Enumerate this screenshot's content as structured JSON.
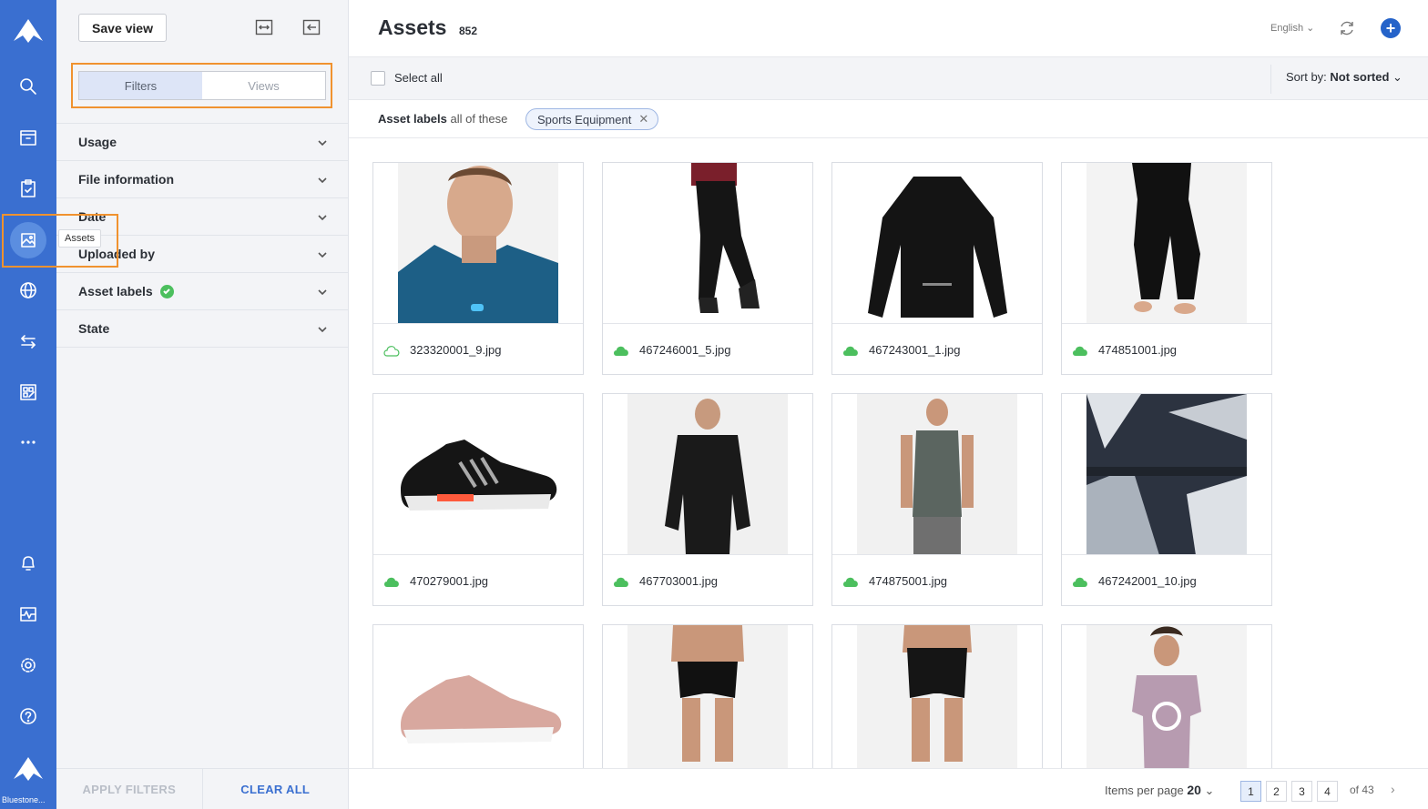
{
  "rail": {
    "user_label": "Bluestone...",
    "tooltip": "Assets",
    "items": [
      "logo-icon",
      "search-icon",
      "archive-icon",
      "clipboard-icon",
      "image-icon",
      "globe-icon",
      "transfer-icon",
      "dashboard-icon",
      "more-icon",
      "bell-icon",
      "activity-icon",
      "gear-icon",
      "help-icon",
      "brand-icon"
    ]
  },
  "filter_panel": {
    "save_view_label": "Save view",
    "tabs": [
      {
        "label": "Filters",
        "active": true
      },
      {
        "label": "Views",
        "active": false
      }
    ],
    "sections": [
      {
        "label": "Usage"
      },
      {
        "label": "File information"
      },
      {
        "label": "Date"
      },
      {
        "label": "Uploaded by"
      },
      {
        "label": "Asset labels"
      },
      {
        "label": "State"
      }
    ],
    "apply_label": "APPLY FILTERS",
    "clear_label": "CLEAR ALL"
  },
  "header": {
    "title": "Assets",
    "count": "852",
    "language": "English"
  },
  "toolbar": {
    "select_all": "Select all",
    "sort_prefix": "Sort by:",
    "sort_value": "Not sorted"
  },
  "active_filter": {
    "label": "Asset labels",
    "qualifier": "all of these",
    "chip": "Sports Equipment"
  },
  "assets": [
    {
      "name": "323320001_9.jpg",
      "synced": false
    },
    {
      "name": "467246001_5.jpg",
      "synced": true
    },
    {
      "name": "467243001_1.jpg",
      "synced": true
    },
    {
      "name": "474851001.jpg",
      "synced": true
    },
    {
      "name": "470279001.jpg",
      "synced": true
    },
    {
      "name": "467703001.jpg",
      "synced": true
    },
    {
      "name": "474875001.jpg",
      "synced": true
    },
    {
      "name": "467242001_10.jpg",
      "synced": true
    },
    {
      "name": "",
      "synced": true
    },
    {
      "name": "",
      "synced": true
    },
    {
      "name": "",
      "synced": true
    },
    {
      "name": "",
      "synced": true
    }
  ],
  "pagination": {
    "items_per_page_label": "Items per page",
    "items_per_page": "20",
    "pages": [
      "1",
      "2",
      "3",
      "4"
    ],
    "current": "1",
    "of_label": "of 43"
  },
  "colors": {
    "rail": "#3a6fd0",
    "accent": "#2563c9",
    "highlight": "#f0922f",
    "synced": "#4cbf5e"
  }
}
